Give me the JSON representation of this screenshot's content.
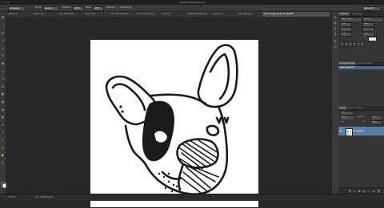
{
  "window": {
    "title": "Adobe Photoshop CC"
  },
  "options_bar": {
    "tool_preset": "Paragraph",
    "items": [
      "Mode:",
      "Normal",
      "Opacity:",
      "100%",
      "Flow:",
      "100%",
      "Airbrush",
      "Smoothing"
    ],
    "workspace": "Essentials"
  },
  "doc_tabs": [
    {
      "label": "Untitled-1"
    },
    {
      "label": "Sketch.psd"
    },
    {
      "label": "Dog Sketch.psd"
    },
    {
      "label": "Sketch.psd"
    },
    {
      "label": "Scan 01 Photoshop"
    },
    {
      "label": "Scan 02 Photoshop"
    },
    {
      "label": "Artboard"
    },
    {
      "label": "MONOCHROME_DOG"
    },
    {
      "label": "Untitled-2"
    },
    {
      "label": "IMG_0081.JPG"
    },
    {
      "label": "Scan 73.jpeg @ 33.3% (RGB/8)"
    }
  ],
  "tools": [
    "move-tool",
    "marquee-tool",
    "lasso-tool",
    "magic-wand-tool",
    "crop-tool",
    "eyedropper-tool",
    "healing-brush-tool",
    "brush-tool",
    "clone-stamp-tool",
    "history-brush-tool",
    "eraser-tool",
    "gradient-tool",
    "blur-tool",
    "dodge-tool",
    "pen-tool",
    "type-tool",
    "path-selection-tool",
    "rectangle-tool",
    "hand-tool",
    "zoom-tool"
  ],
  "tool_glyphs": [
    "✥",
    "⬚",
    "ʘ",
    "✶",
    "⌗",
    "✎",
    "✚",
    "✏",
    "⎔",
    "↺",
    "◧",
    "▤",
    "◍",
    "◐",
    "✒",
    "T",
    "↖",
    "▭",
    "✋",
    "⚲"
  ],
  "colors": {
    "foreground": "#111111",
    "background": "#ffffff",
    "accent": "#5b7da3"
  },
  "character_panel": {
    "tabs": [
      "Character",
      "Paragraph"
    ],
    "font": "Apple LiGothic",
    "style": "Medium",
    "size": "12 pt",
    "leading": "(Auto)",
    "tracking": "0",
    "scale": "100%",
    "color_label": "Color:"
  },
  "paragraph_styles_panel": {
    "tabs": [
      "Paragraph Styles",
      "Character Styles"
    ],
    "selected_item": "Basic Paragraph"
  },
  "layers_panel": {
    "tabs": [
      "Layers",
      "Channels",
      "Paths"
    ],
    "kind_filter": "Kind",
    "blend_mode": "Normal",
    "opacity_label": "Opacity:",
    "opacity": "100%",
    "lock_label": "Lock:",
    "fill_label": "Fill:",
    "fill": "100%",
    "layers": [
      {
        "name": "Background",
        "selected": true,
        "visible": true
      }
    ]
  },
  "status_bar": {
    "zoom": "33.33%",
    "doc_info": "Doc: 24.9M/24.9M"
  }
}
